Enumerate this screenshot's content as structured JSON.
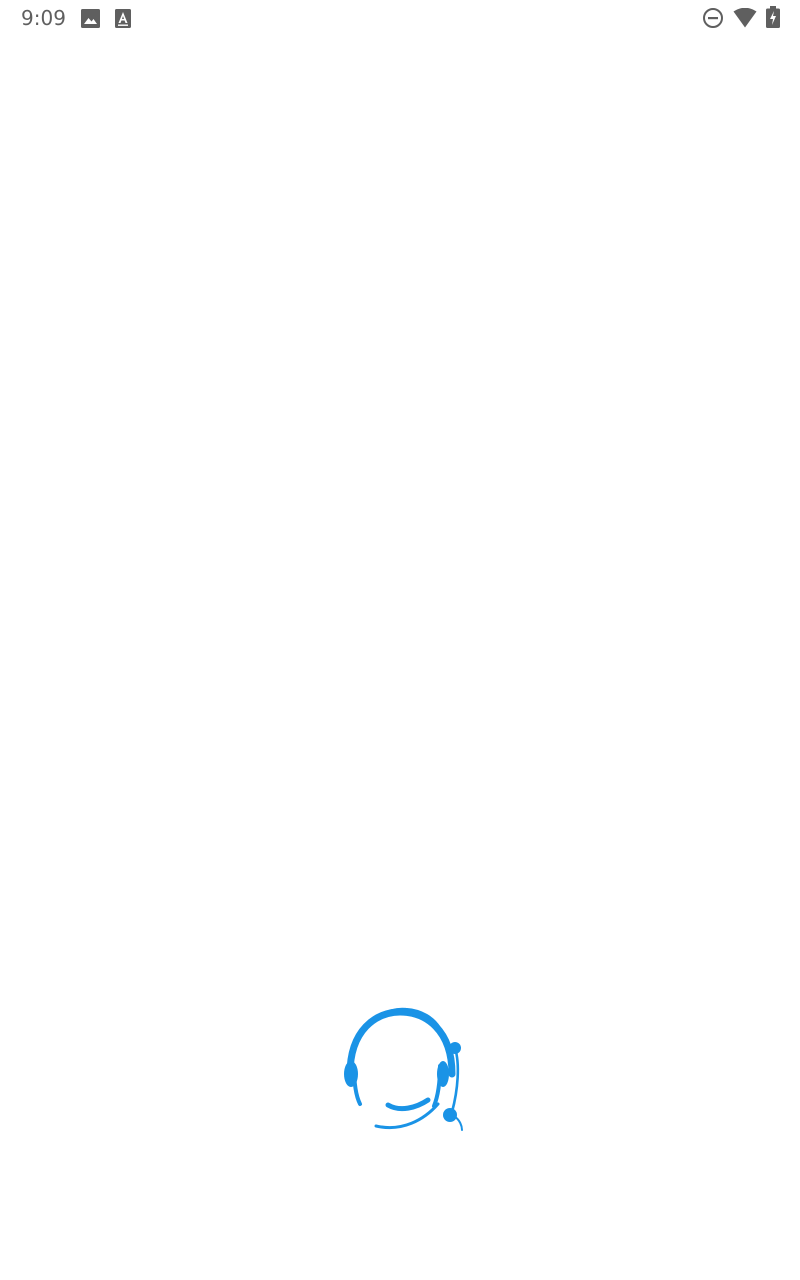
{
  "status_bar": {
    "time": "9:09",
    "icons": {
      "left": [
        "image-icon",
        "text-icon"
      ],
      "right": [
        "do-not-disturb-icon",
        "wifi-icon",
        "battery-charging-icon"
      ]
    },
    "icon_color": "#5f5f5f"
  },
  "splash": {
    "logo_icon": "headset-agent-icon",
    "brand_color": "#1a93e6"
  }
}
